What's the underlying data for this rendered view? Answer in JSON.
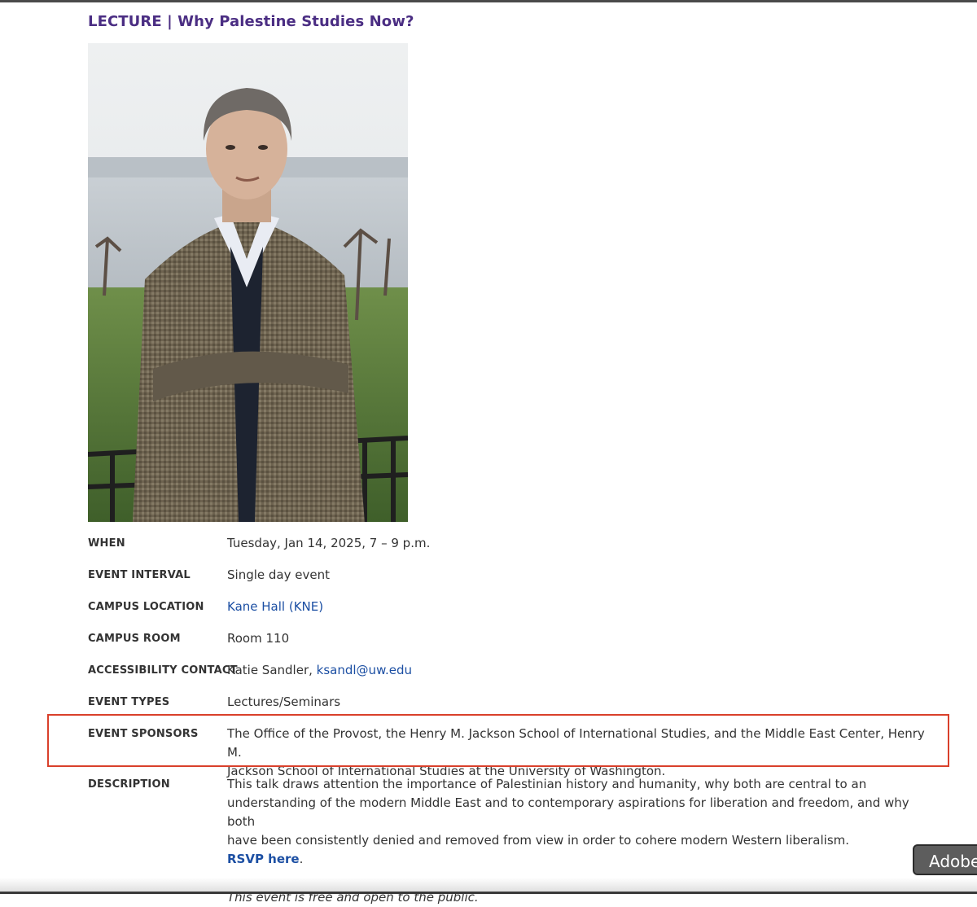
{
  "event": {
    "title": "LECTURE | Why Palestine Studies Now?"
  },
  "details": {
    "when": {
      "label": "WHEN",
      "value": "Tuesday, Jan 14, 2025, 7 – 9 p.m."
    },
    "interval": {
      "label": "EVENT INTERVAL",
      "value": "Single day event"
    },
    "location": {
      "label": "CAMPUS LOCATION",
      "value": "Kane Hall (KNE)"
    },
    "room": {
      "label": "CAMPUS ROOM",
      "value": "Room 110"
    },
    "accessibility": {
      "label": "ACCESSIBILITY CONTACT",
      "name": "Katie Sandler,",
      "email": "ksandl@uw.edu"
    },
    "types": {
      "label": "EVENT TYPES",
      "value": "Lectures/Seminars"
    },
    "sponsors": {
      "label": "EVENT SPONSORS",
      "line1": "The Office of the Provost, the Henry M. Jackson School of International Studies, and the Middle East Center, Henry M.",
      "line2": "Jackson School of International Studies at the University of Washington."
    },
    "description": {
      "label": "DESCRIPTION",
      "line1": "This talk draws attention the importance of Palestinian history and humanity, why both are central to an",
      "line2": "understanding of the modern Middle East and to contemporary aspirations for liberation and freedom, and why both",
      "line3": "have been consistently denied and removed from view in order to cohere modern Western liberalism.",
      "rsvp_label": "RSVP here",
      "rsvp_suffix": ".",
      "note": "This event is free and open to the public."
    }
  },
  "overlay": {
    "adobe_button_label": "Adobe"
  },
  "colors": {
    "title": "#4b2e83",
    "link": "#1c4fa3",
    "highlight": "#d9402b"
  }
}
